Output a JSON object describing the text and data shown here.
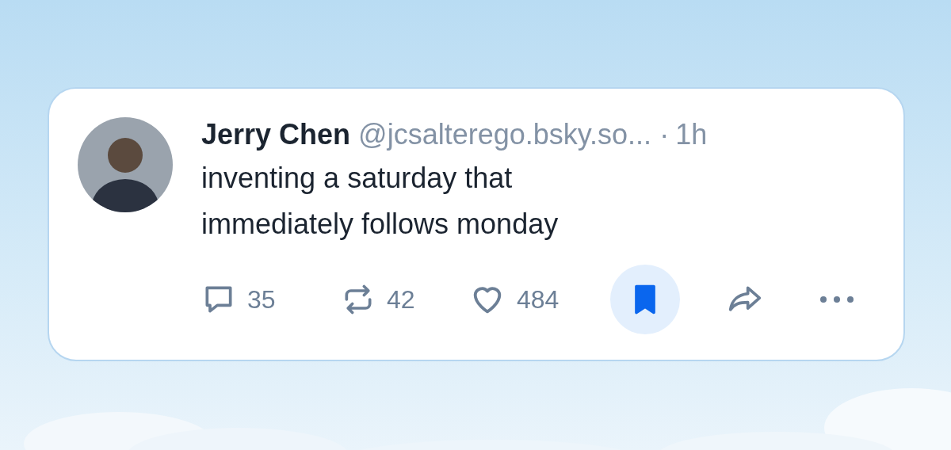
{
  "post": {
    "author": "Jerry Chen",
    "handle": "@jcsalterego.bsky.so...",
    "separator": "·",
    "time": "1h",
    "text": "inventing a saturday that immediately follows monday",
    "actions": [
      {
        "kind": "reply",
        "count": "35"
      },
      {
        "kind": "repost",
        "count": "42",
        "on": false
      },
      {
        "kind": "like",
        "count": "484",
        "on": false
      },
      {
        "kind": "bookmark",
        "on": true
      },
      {
        "kind": "share"
      },
      {
        "kind": "more"
      }
    ]
  }
}
